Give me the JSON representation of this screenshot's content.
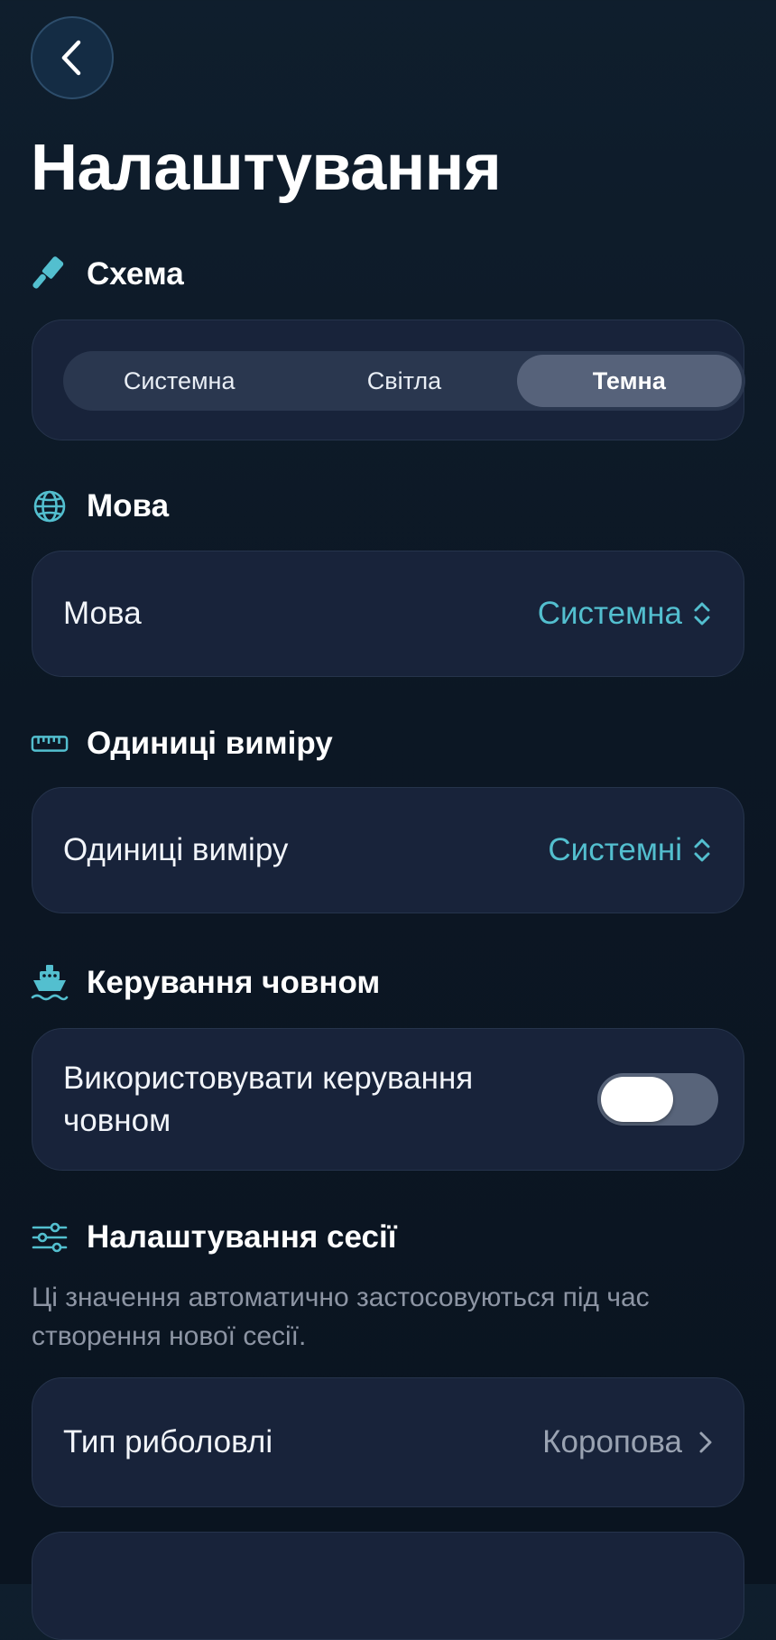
{
  "page": {
    "title": "Налаштування"
  },
  "theme": {
    "accent": "#53bfcf",
    "background": "#0c1724",
    "card": "#18233a"
  },
  "scheme": {
    "heading": "Схема",
    "icon": "paintbrush-icon",
    "options": [
      "Системна",
      "Світла",
      "Темна"
    ],
    "selected": "Темна"
  },
  "language": {
    "heading": "Мова",
    "icon": "globe-icon",
    "row_label": "Мова",
    "value": "Системна"
  },
  "units": {
    "heading": "Одиниці виміру",
    "icon": "ruler-icon",
    "row_label": "Одиниці виміру",
    "value": "Системні"
  },
  "boat": {
    "heading": "Керування човном",
    "icon": "boat-icon",
    "row_label_line1": "Використовувати керування",
    "row_label_line2": "човном",
    "toggle_on": false
  },
  "session": {
    "heading": "Налаштування сесії",
    "icon": "sliders-icon",
    "description_line1": "Ці значення автоматично застосовуються під час",
    "description_line2": "створення нової сесії.",
    "fishing_type_label": "Тип риболовлі",
    "fishing_type_value": "Коропова"
  }
}
